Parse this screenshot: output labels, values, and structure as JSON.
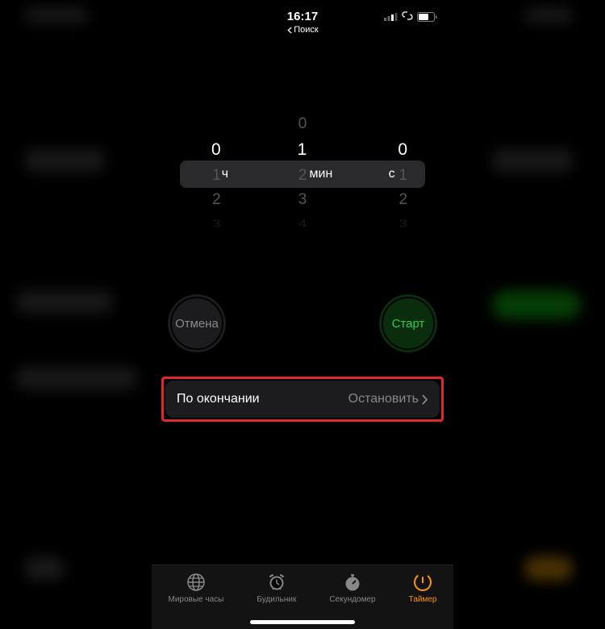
{
  "status": {
    "time": "16:17",
    "back_label": "Поиск"
  },
  "picker": {
    "hours": {
      "selected": "0",
      "below": [
        "1",
        "2",
        "3"
      ],
      "unit": "ч"
    },
    "minutes": {
      "above": [
        "0"
      ],
      "selected": "1",
      "below": [
        "2",
        "3",
        "4"
      ],
      "unit": "мин"
    },
    "seconds": {
      "selected": "0",
      "below": [
        "1",
        "2",
        "3"
      ],
      "unit": "с"
    }
  },
  "buttons": {
    "cancel": "Отмена",
    "start": "Старт"
  },
  "end_action": {
    "label": "По окончании",
    "value": "Остановить"
  },
  "tabs": {
    "world_clock": "Мировые часы",
    "alarm": "Будильник",
    "stopwatch": "Секундомер",
    "timer": "Таймер"
  }
}
